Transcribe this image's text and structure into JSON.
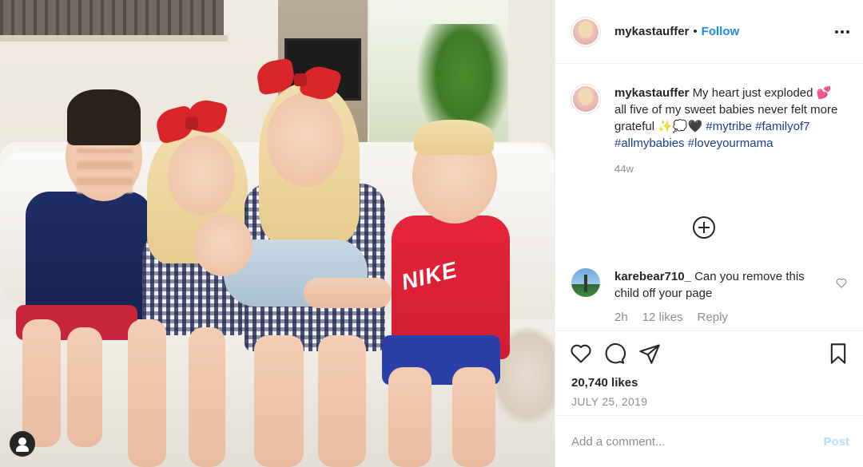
{
  "post": {
    "username": "mykastauffer",
    "separator": "•",
    "follow_label": "Follow",
    "more_icon": "more-horizontal-icon"
  },
  "caption": {
    "username": "mykastauffer",
    "text_before": "My heart just exploded",
    "emoji_heart": "💕",
    "text_mid": "all five of my sweet babies never felt more grateful",
    "emoji_end": "✨💭🖤",
    "hashtags": [
      "#mytribe",
      "#familyof7",
      "#allmybabies",
      "#loveyourmama"
    ],
    "age": "44w"
  },
  "load_more_icon": "plus-circle-icon",
  "comments": [
    {
      "username": "karebear710_",
      "text": "Can you remove this child off your page",
      "time": "2h",
      "likes": "12 likes",
      "reply": "Reply"
    }
  ],
  "actions": {
    "like_icon": "heart-icon",
    "comment_icon": "comment-icon",
    "share_icon": "send-icon",
    "save_icon": "bookmark-icon"
  },
  "likes_count": "20,740 likes",
  "date": "JULY 25, 2019",
  "add_comment": {
    "placeholder": "Add a comment...",
    "post_label": "Post"
  },
  "colors": {
    "link_blue": "#1a8be6",
    "hashtag": "#1b3f8c",
    "muted": "#8e8e8e",
    "post_disabled": "#b2dffc"
  }
}
